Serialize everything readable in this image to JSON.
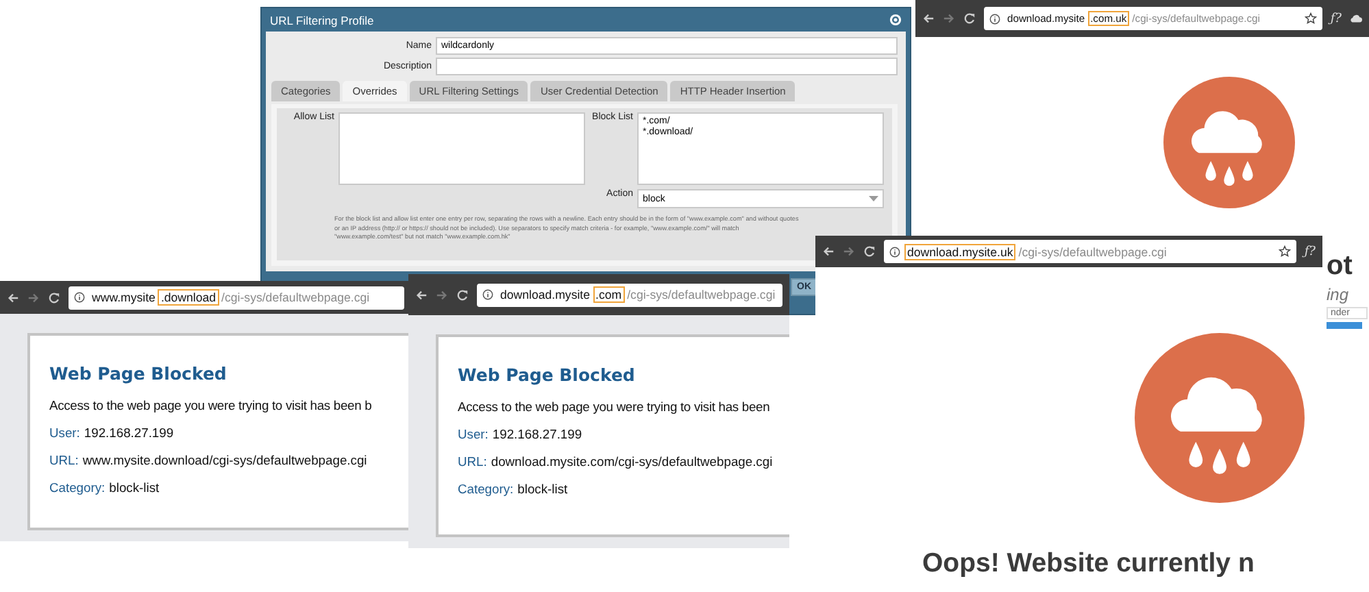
{
  "profile_dialog": {
    "title": "URL Filtering Profile",
    "fields": [
      {
        "label": "Name",
        "value": "wildcardonly"
      },
      {
        "label": "Description"
      }
    ],
    "tabs": [
      {
        "label": "Categories",
        "selected": false
      },
      {
        "label": "Overrides",
        "selected": true
      },
      {
        "label": "URL Filtering Settings",
        "selected": false
      },
      {
        "label": "User Credential Detection",
        "selected": false
      },
      {
        "label": "HTTP Header Insertion",
        "selected": false
      }
    ],
    "allow_list": {
      "label": "Allow List"
    },
    "block_list": {
      "label": "Block List",
      "entries": [
        "*.com/",
        "*.download/"
      ]
    },
    "action": {
      "label": "Action",
      "value": "block"
    },
    "help_text": "For the block list and allow list enter one entry per row, separating the rows with a newline. Each entry should be in the form of \"www.example.com\" and without quotes\nor an IP address (http:// or https:// should not be included). Use separators to specify match criteria - for example, \"www.example.com/\" will match\n\"www.example.com/test\" but not match \"www.example.com.hk\"",
    "ok_button": "OK"
  },
  "browsers": [
    {
      "address": [
        {
          "text": "download.mysite",
          "kind": "host",
          "highlighted": false
        },
        {
          "text": ".com.uk",
          "kind": "host",
          "highlighted": true
        },
        {
          "text": "/cgi-sys/defaultwebpage.cgi",
          "kind": "path",
          "highlighted": false
        }
      ],
      "bookmark_star": true,
      "extension_label": "ƒ?",
      "extra_icon": true,
      "page": {
        "kind": "error",
        "fragments": [
          {
            "kind": "heading",
            "text": "ot"
          },
          {
            "kind": "italic",
            "text": "ing"
          },
          {
            "kind": "field",
            "text": "nder"
          }
        ]
      }
    },
    {
      "address": [
        {
          "text": "www.mysite",
          "kind": "host",
          "highlighted": false
        },
        {
          "text": ".download",
          "kind": "host",
          "highlighted": true
        },
        {
          "text": "/cgi-sys/defaultwebpage.cgi",
          "kind": "path",
          "highlighted": false
        }
      ],
      "bookmark_star": false,
      "page": {
        "kind": "blocked",
        "title": "Web Page Blocked",
        "message": "Access to the web page you were trying to visit has been b",
        "details": [
          {
            "label": "User:",
            "value": "192.168.27.199"
          },
          {
            "label": "URL:",
            "value": "www.mysite.download/cgi-sys/defaultwebpage.cgi"
          },
          {
            "label": "Category:",
            "value": "block-list"
          }
        ]
      }
    },
    {
      "address": [
        {
          "text": "download.mysite",
          "kind": "host",
          "highlighted": false
        },
        {
          "text": ".com",
          "kind": "host",
          "highlighted": true
        },
        {
          "text": "/cgi-sys/defaultwebpage.cgi",
          "kind": "path",
          "highlighted": false
        }
      ],
      "bookmark_star": false,
      "page": {
        "kind": "blocked",
        "title": "Web Page Blocked",
        "message": "Access to the web page you were trying to visit has been",
        "details": [
          {
            "label": "User:",
            "value": "192.168.27.199"
          },
          {
            "label": "URL:",
            "value": "download.mysite.com/cgi-sys/defaultwebpage.cgi"
          },
          {
            "label": "Category:",
            "value": "block-list"
          }
        ]
      }
    },
    {
      "address": [
        {
          "text": "download.mysite.uk",
          "kind": "host",
          "highlighted": true
        },
        {
          "text": "/cgi-sys/defaultwebpage.cgi",
          "kind": "path",
          "highlighted": false
        }
      ],
      "bookmark_star": true,
      "extension_label": "ƒ?",
      "page": {
        "kind": "error",
        "heading": "Oops! Website currently n"
      }
    }
  ]
}
